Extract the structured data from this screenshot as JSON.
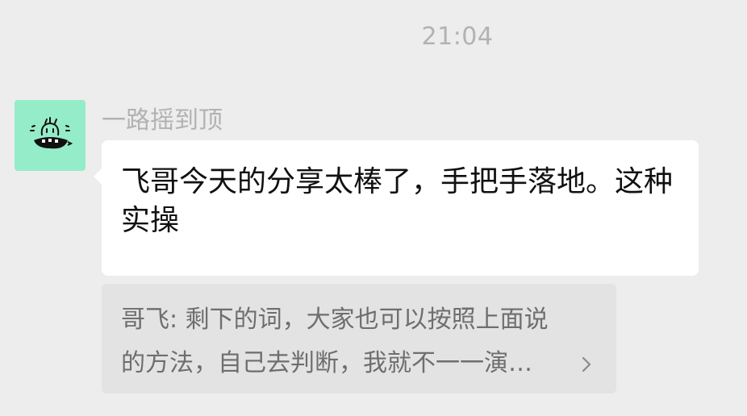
{
  "timestamp": "21:04",
  "message": {
    "sender": "一路摇到顶",
    "avatar_icon": "cartoon-face-icon",
    "avatar_color": "#95ecc8",
    "text": "飞哥今天的分享太棒了，手把手落地。这种实操"
  },
  "quote": {
    "line1": "哥飞: 剩下的词，大家也可以按照上面说",
    "line2": "的方法，自己去判断，我就不一一演…"
  }
}
